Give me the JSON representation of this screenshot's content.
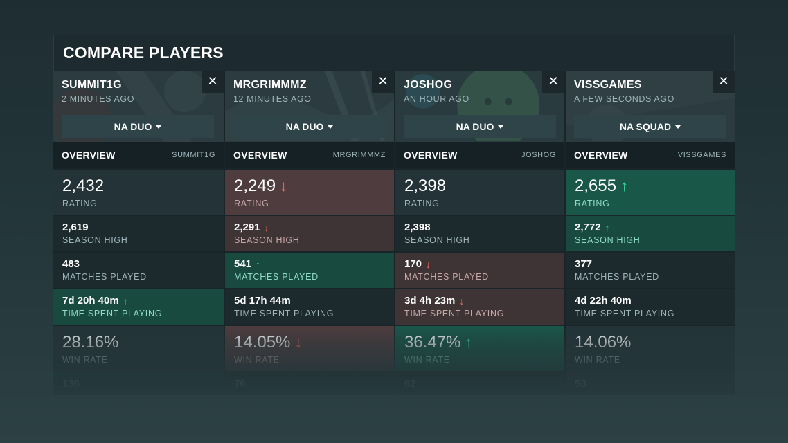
{
  "title": "COMPARE PLAYERS",
  "colors": {
    "up": "#39d9a2",
    "down": "#ef6e61",
    "upBg": "#195748",
    "downBg": "#4f3c3e"
  },
  "players": [
    {
      "name": "SUMMIT1G",
      "updated": "2 MINUTES AGO",
      "mode": "NA DUO",
      "tab": "OVERVIEW",
      "tab_user": "SUMMIT1G",
      "stats": [
        {
          "value": "2,432",
          "label": "RATING",
          "trend": "none"
        },
        {
          "value": "2,619",
          "label": "SEASON HIGH",
          "trend": "none"
        },
        {
          "value": "483",
          "label": "MATCHES PLAYED",
          "trend": "none"
        },
        {
          "value": "7d 20h 40m",
          "label": "TIME SPENT PLAYING",
          "trend": "up"
        },
        {
          "value": "28.16%",
          "label": "WIN RATE",
          "trend": "none"
        },
        {
          "value": "136",
          "label": "",
          "trend": "up"
        }
      ]
    },
    {
      "name": "MRGRIMMMZ",
      "updated": "12 MINUTES AGO",
      "mode": "NA DUO",
      "tab": "OVERVIEW",
      "tab_user": "MRGRIMMMZ",
      "stats": [
        {
          "value": "2,249",
          "label": "RATING",
          "trend": "down"
        },
        {
          "value": "2,291",
          "label": "SEASON HIGH",
          "trend": "down"
        },
        {
          "value": "541",
          "label": "MATCHES PLAYED",
          "trend": "up"
        },
        {
          "value": "5d 17h 44m",
          "label": "TIME SPENT PLAYING",
          "trend": "none"
        },
        {
          "value": "14.05%",
          "label": "WIN RATE",
          "trend": "down"
        },
        {
          "value": "76",
          "label": "",
          "trend": "none"
        }
      ]
    },
    {
      "name": "JOSHOG",
      "updated": "AN HOUR AGO",
      "mode": "NA DUO",
      "tab": "OVERVIEW",
      "tab_user": "JOSHOG",
      "stats": [
        {
          "value": "2,398",
          "label": "RATING",
          "trend": "none"
        },
        {
          "value": "2,398",
          "label": "SEASON HIGH",
          "trend": "none"
        },
        {
          "value": "170",
          "label": "MATCHES PLAYED",
          "trend": "down"
        },
        {
          "value": "3d 4h 23m",
          "label": "TIME SPENT PLAYING",
          "trend": "down"
        },
        {
          "value": "36.47%",
          "label": "WIN RATE",
          "trend": "up"
        },
        {
          "value": "62",
          "label": "",
          "trend": "none"
        }
      ]
    },
    {
      "name": "VISSGAMES",
      "updated": "A FEW SECONDS AGO",
      "mode": "NA SQUAD",
      "tab": "OVERVIEW",
      "tab_user": "VISSGAMES",
      "stats": [
        {
          "value": "2,655",
          "label": "RATING",
          "trend": "up"
        },
        {
          "value": "2,772",
          "label": "SEASON HIGH",
          "trend": "up"
        },
        {
          "value": "377",
          "label": "MATCHES PLAYED",
          "trend": "none"
        },
        {
          "value": "4d 22h 40m",
          "label": "TIME SPENT PLAYING",
          "trend": "none"
        },
        {
          "value": "14.06%",
          "label": "WIN RATE",
          "trend": "none"
        },
        {
          "value": "53",
          "label": "",
          "trend": "down"
        }
      ]
    }
  ]
}
